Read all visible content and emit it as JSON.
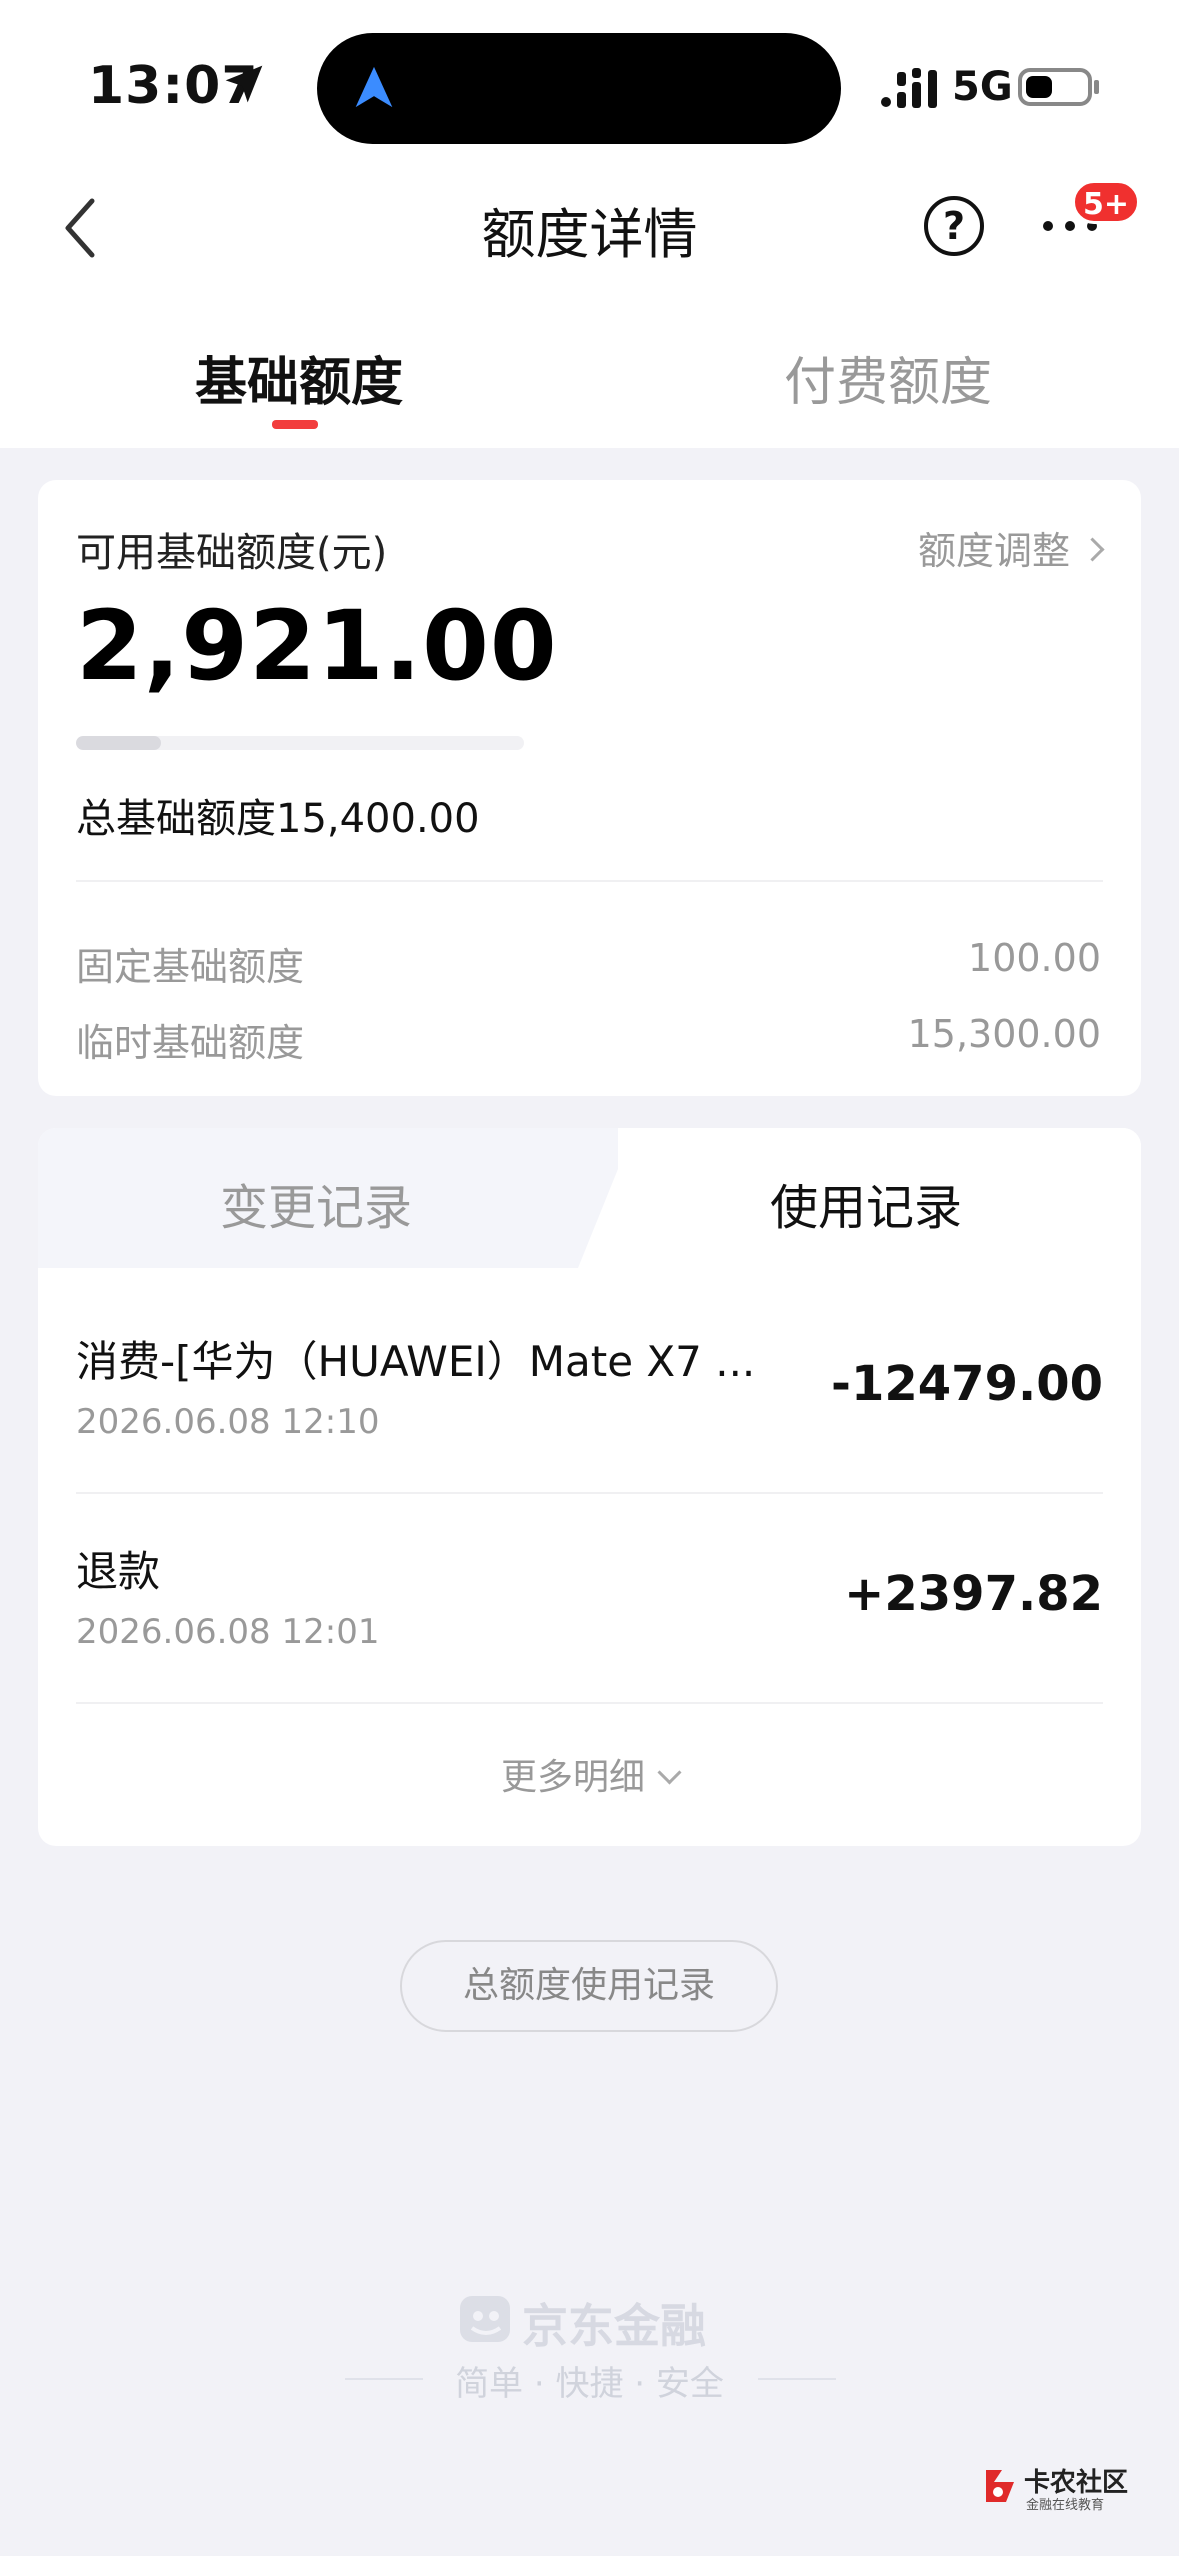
{
  "status_bar": {
    "time": "13:07",
    "network": "5G"
  },
  "nav": {
    "title": "额度详情",
    "help": "?",
    "badge": "5+"
  },
  "top_tabs": [
    {
      "label": "基础额度",
      "active": true
    },
    {
      "label": "付费额度",
      "active": false
    }
  ],
  "credit": {
    "available_label": "可用基础额度(元)",
    "adjust_label": "额度调整",
    "available_amount": "2,921.00",
    "usage_fraction": 0.19,
    "total_label": "总基础额度15,400.00",
    "rows": [
      {
        "label": "固定基础额度",
        "value": "100.00"
      },
      {
        "label": "临时基础额度",
        "value": "15,300.00"
      }
    ]
  },
  "records": {
    "tabs": [
      {
        "label": "变更记录",
        "active": false
      },
      {
        "label": "使用记录",
        "active": true
      }
    ],
    "items": [
      {
        "title": "消费-[华为（HUAWEI）Mate X7 ...",
        "time": "2026.06.08 12:10",
        "amount": "-12479.00"
      },
      {
        "title": "退款",
        "time": "2026.06.08 12:01",
        "amount": "+2397.82"
      }
    ],
    "more_label": "更多明细"
  },
  "total_usage_button": "总额度使用记录",
  "footer": {
    "brand": "京东金融",
    "slogan": "简单 · 快捷 · 安全"
  },
  "watermark": {
    "name": "卡农社区",
    "sub": "金融在线教育"
  },
  "colors": {
    "accent": "#f23d3d",
    "badge": "#f0302f",
    "muted": "#999999"
  }
}
